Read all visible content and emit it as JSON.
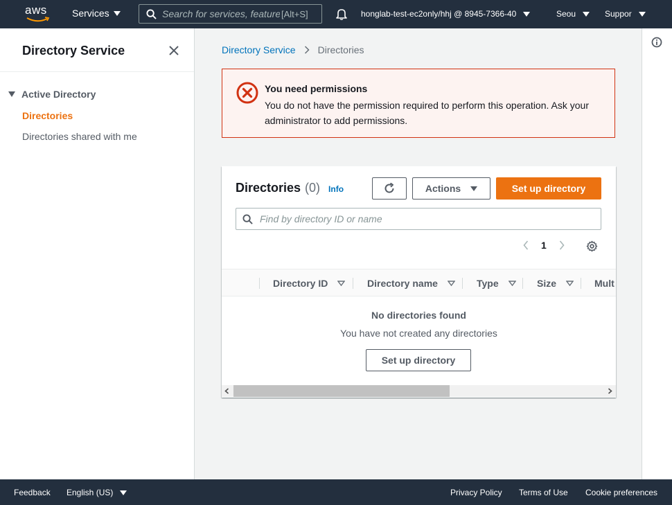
{
  "topnav": {
    "logo_text": "aws",
    "services_label": "Services",
    "search_placeholder": "Search for services, features",
    "search_shortcut": "[Alt+S]",
    "account_label": "honglab-test-ec2only/hhj @ 8945-7366-40",
    "region_label": "Seou",
    "support_label": "Suppor"
  },
  "sidebar": {
    "title": "Directory Service",
    "section_label": "Active Directory",
    "items": [
      {
        "label": "Directories",
        "active": true
      },
      {
        "label": "Directories shared with me",
        "active": false
      }
    ]
  },
  "breadcrumb": {
    "parent": "Directory Service",
    "current": "Directories"
  },
  "alert": {
    "title": "You need permissions",
    "body": "You do not have the permission required to perform this operation. Ask your administrator to add permissions."
  },
  "panel": {
    "title": "Directories",
    "count": "(0)",
    "info_label": "Info",
    "actions_label": "Actions",
    "setup_label": "Set up directory",
    "filter_placeholder": "Find by directory ID or name",
    "page_number": "1",
    "columns": [
      "Directory ID",
      "Directory name",
      "Type",
      "Size",
      "Mult"
    ],
    "empty_title": "No directories found",
    "empty_subtitle": "You have not created any directories",
    "empty_button": "Set up directory"
  },
  "footer": {
    "feedback": "Feedback",
    "language": "English (US)",
    "privacy": "Privacy Policy",
    "terms": "Terms of Use",
    "cookies": "Cookie preferences"
  },
  "colors": {
    "nav_bg": "#232f3e",
    "accent": "#ec7211",
    "link": "#0073bb",
    "error": "#d13212"
  }
}
